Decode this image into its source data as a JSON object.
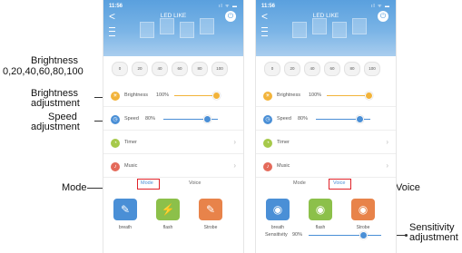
{
  "phone": {
    "time": "11:56",
    "signal": "ıl ᯤ ▬",
    "back_glyph": "<",
    "title": "LED LIKE",
    "power_glyph": "⏻"
  },
  "brightness_presets": [
    "0",
    "20",
    "40",
    "60",
    "80",
    "100"
  ],
  "rows": {
    "brightness": {
      "label": "Brightness",
      "value": "100%",
      "level": 1.0,
      "color": "#f2b33a"
    },
    "speed": {
      "label": "Speed",
      "value": "80%",
      "level": 0.8,
      "color": "#4a8fd6"
    },
    "timer": {
      "label": "Timer",
      "color": "#a6c94a"
    },
    "music": {
      "label": "Music",
      "color": "#e46a5a"
    }
  },
  "tabs": {
    "mode": "Mode",
    "voice": "Voice"
  },
  "left_tiles": [
    {
      "label": "breath",
      "icon": "✎",
      "color": "#4a8fd6"
    },
    {
      "label": "flash",
      "icon": "⚡",
      "color": "#8cc04a"
    },
    {
      "label": "Strobe",
      "icon": "✎",
      "color": "#e8834a"
    }
  ],
  "right_tiles": [
    {
      "label": "breath",
      "icon": "◉",
      "color": "#4a8fd6"
    },
    {
      "label": "flash",
      "icon": "◉",
      "color": "#8cc04a"
    },
    {
      "label": "Strobe",
      "icon": "◉",
      "color": "#e8834a"
    }
  ],
  "sensitivity": {
    "label": "Sensitivity",
    "value": "90%",
    "level": 0.9
  },
  "callouts": {
    "brightness_title": "Brightness",
    "brightness_values": "0,20,40,60,80,100",
    "brightness_adj_1": "Brightness",
    "brightness_adj_2": "adjustment",
    "speed_adj_1": "Speed",
    "speed_adj_2": "adjustment",
    "mode": "Mode",
    "voice": "Voice",
    "sens_1": "Sensitivity",
    "sens_2": "adjustment"
  },
  "colors": {
    "highlight": "#e0232a",
    "accent": "#4a8fd6"
  }
}
